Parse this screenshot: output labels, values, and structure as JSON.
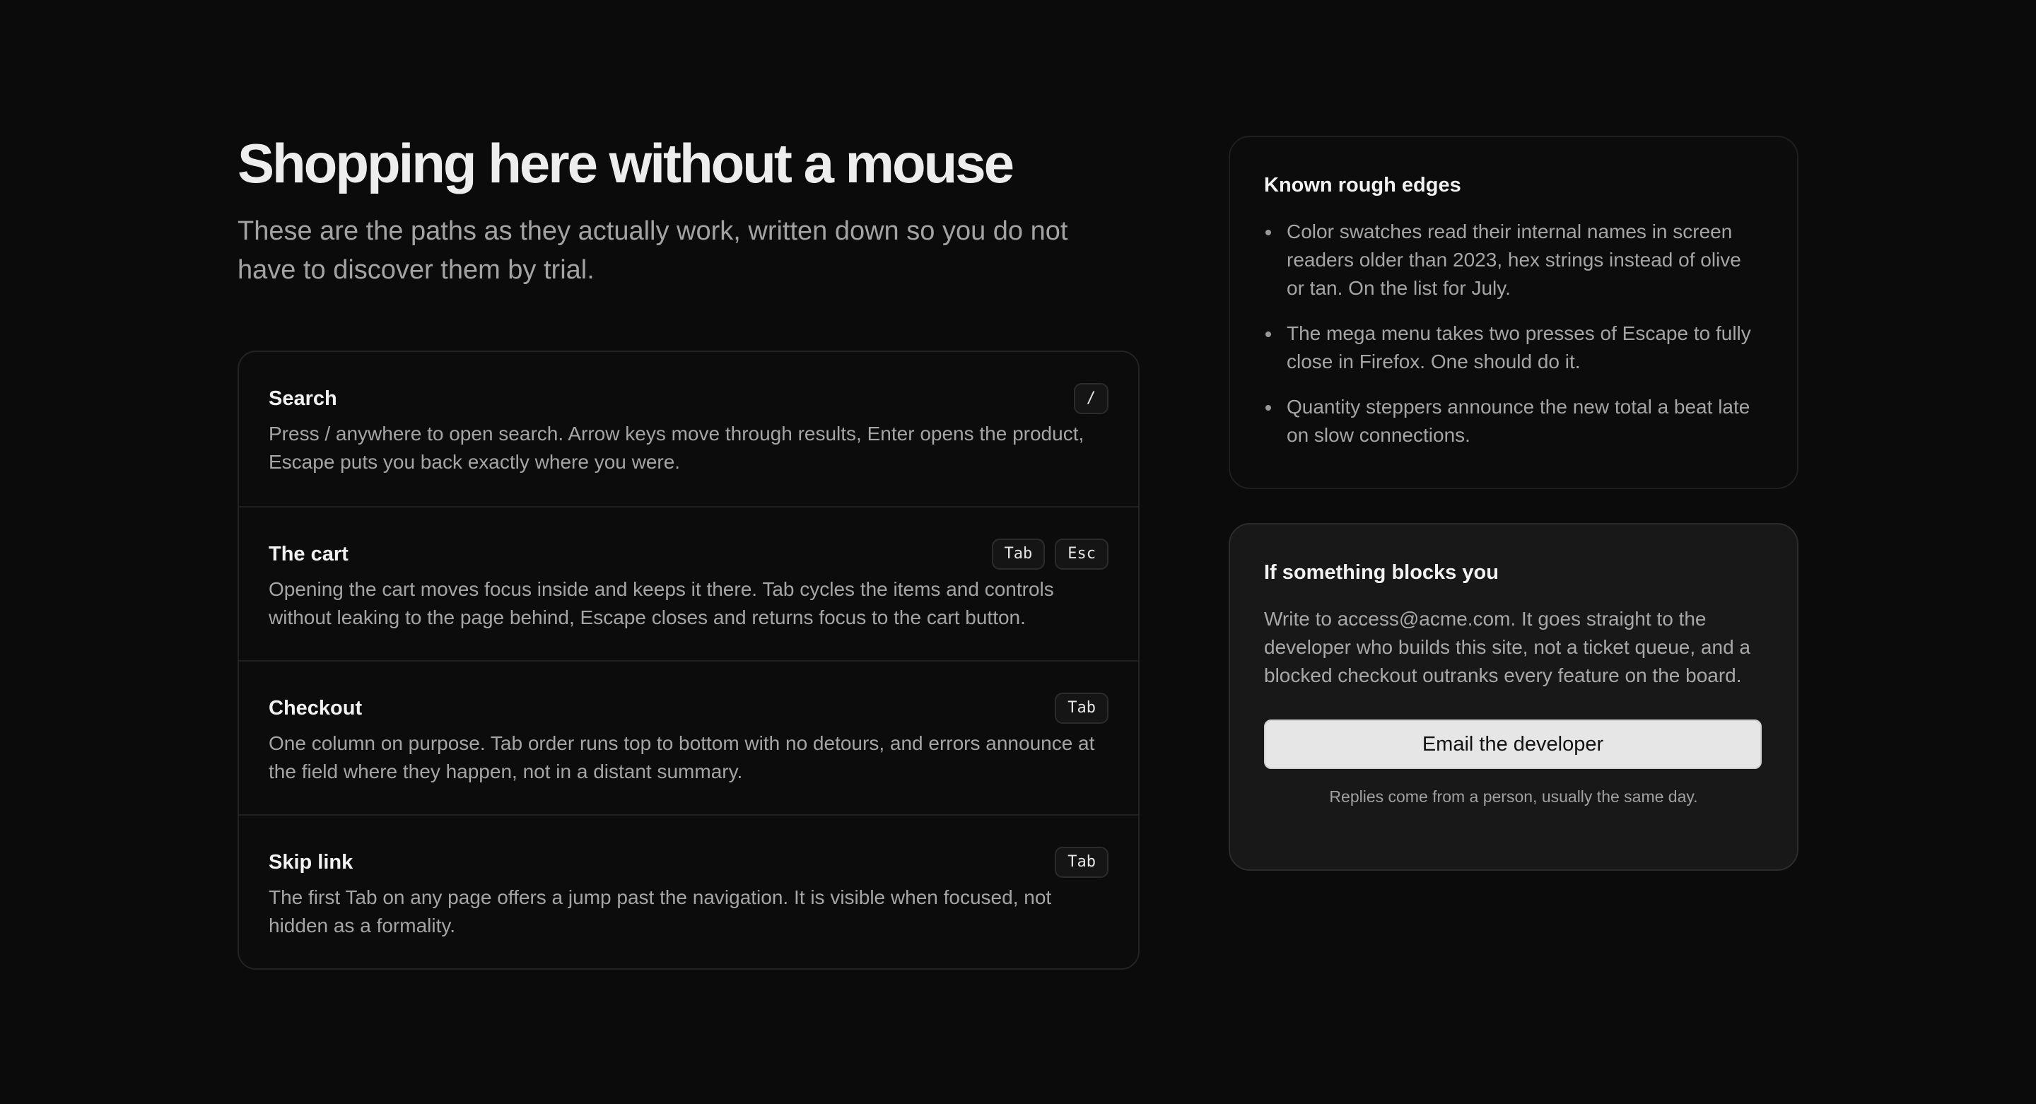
{
  "page": {
    "title": "Shopping here without a mouse",
    "subtitle": "These are the paths as they actually work, written down so you do not have to discover them by trial."
  },
  "paths": [
    {
      "name": "Search",
      "keys": [
        "/"
      ],
      "description": "Press / anywhere to open search. Arrow keys move through results, Enter opens the product, Escape puts you back exactly where you were."
    },
    {
      "name": "The cart",
      "keys": [
        "Tab",
        "Esc"
      ],
      "description": "Opening the cart moves focus inside and keeps it there. Tab cycles the items and controls without leaking to the page behind, Escape closes and returns focus to the cart button."
    },
    {
      "name": "Checkout",
      "keys": [
        "Tab"
      ],
      "description": "One column on purpose. Tab order runs top to bottom with no detours, and errors announce at the field where they happen, not in a distant summary."
    },
    {
      "name": "Skip link",
      "keys": [
        "Tab"
      ],
      "description": "The first Tab on any page offers a jump past the navigation. It is visible when focused, not hidden as a formality."
    }
  ],
  "rough_edges": {
    "title": "Known rough edges",
    "items": [
      "Color swatches read their internal names in screen readers older than 2023, hex strings instead of olive or tan. On the list for July.",
      "The mega menu takes two presses of Escape to fully close in Firefox. One should do it.",
      "Quantity steppers announce the new total a beat late on slow connections."
    ]
  },
  "contact": {
    "title": "If something blocks you",
    "text": "Write to access@acme.com. It goes straight to the developer who builds this site, not a ticket queue, and a blocked checkout outranks every feature on the board.",
    "button_label": "Email the developer",
    "note": "Replies come from a person, usually the same day."
  }
}
